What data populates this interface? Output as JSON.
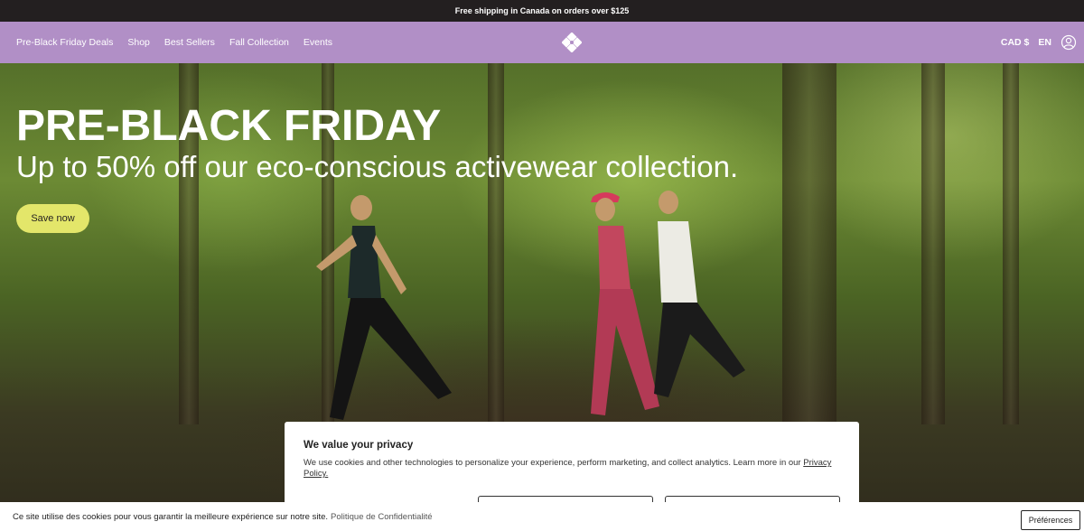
{
  "announcement": "Free shipping in Canada on orders over $125",
  "nav": {
    "links": [
      "Pre-Black Friday Deals",
      "Shop",
      "Best Sellers",
      "Fall Collection",
      "Events"
    ],
    "currency": "CAD $",
    "language": "EN",
    "logo_icon": "flower-logo-icon",
    "account_icon": "account-icon"
  },
  "hero": {
    "title": "PRE-BLACK FRIDAY",
    "subtitle": "Up to 50% off our eco-conscious activewear collection.",
    "cta": "Save now"
  },
  "privacy_modal": {
    "title": "We value your privacy",
    "body": "We use cookies and other technologies to personalize your experience, perform marketing, and collect analytics. Learn more in our",
    "link": "Privacy Policy."
  },
  "cookie_bar": {
    "text": "Ce site utilise des cookies pour vous garantir la meilleure expérience sur notre site.",
    "link": "Politique de Confidentialité",
    "button": "Préférences"
  },
  "colors": {
    "nav_bg": "#b18fc6",
    "announcement_bg": "#231f20",
    "cta_bg": "#e3e66a"
  }
}
